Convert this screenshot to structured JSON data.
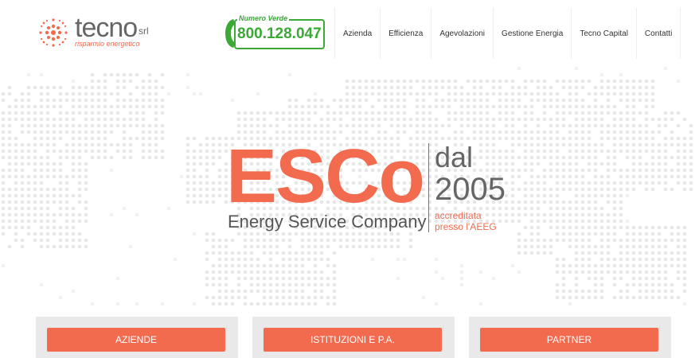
{
  "logo": {
    "name": "tecno",
    "suffix": "srl",
    "tagline": "risparmio energetico",
    "accent": "#f26b4f"
  },
  "phone": {
    "label": "Numero Verde",
    "number": "800.128.047",
    "color": "#3aa935"
  },
  "nav": {
    "items": [
      {
        "label": "Azienda"
      },
      {
        "label": "Efficienza"
      },
      {
        "label": "Agevolazioni"
      },
      {
        "label": "Gestione Energia"
      },
      {
        "label": "Tecno Capital"
      },
      {
        "label": "Contatti"
      }
    ]
  },
  "hero": {
    "title": "ESCo",
    "subtitle": "Energy Service Company",
    "since_label": "dal",
    "since_year": "2005",
    "accredit_line1": "accreditata",
    "accredit_line2": "presso l'AEEG"
  },
  "cta": {
    "buttons": [
      {
        "label": "AZIENDE"
      },
      {
        "label": "ISTITUZIONI E P.A."
      },
      {
        "label": "PARTNER"
      }
    ]
  }
}
